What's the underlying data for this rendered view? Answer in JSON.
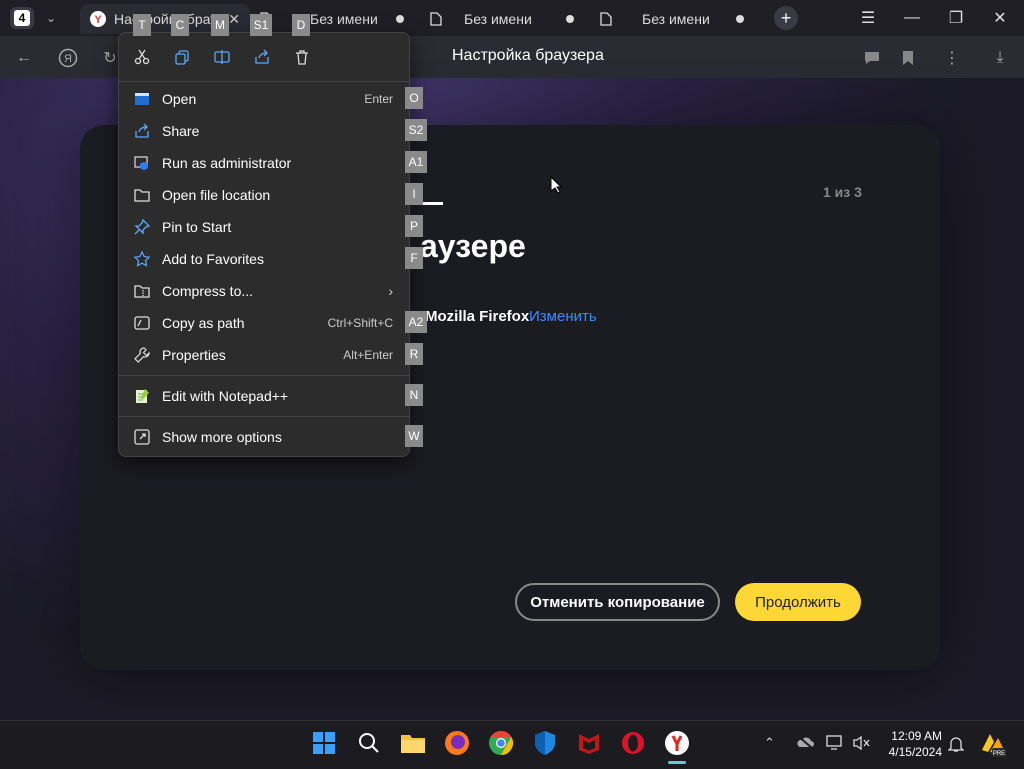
{
  "tabstrip": {
    "tab_count": "4",
    "tabs": [
      {
        "label": "Настройка брау"
      },
      {
        "label": "Без имени"
      },
      {
        "label": "Без имени"
      },
      {
        "label": "Без имени"
      }
    ],
    "new_tab": "+"
  },
  "toolbar": {
    "address_text": "Настройка браузера"
  },
  "page": {
    "step": "1 из 3",
    "heading_fragment": "аузере",
    "source_browser": "Mozilla Firefox",
    "change_link": "Изменить",
    "cancel_button": "Отменить копирование",
    "continue_button": "Продолжить"
  },
  "context_menu": {
    "top_actions": [
      {
        "icon": "cut-icon",
        "key": "T"
      },
      {
        "icon": "copy-icon",
        "key": "C"
      },
      {
        "icon": "rename-icon",
        "key": "M"
      },
      {
        "icon": "share-icon",
        "key": "S1"
      },
      {
        "icon": "delete-icon",
        "key": "D"
      }
    ],
    "items": [
      {
        "label": "Open",
        "shortcut": "Enter",
        "key": "O",
        "icon": "open-icon"
      },
      {
        "label": "Share",
        "shortcut": "",
        "key": "S2",
        "icon": "share-icon"
      },
      {
        "label": "Run as administrator",
        "shortcut": "",
        "key": "A1",
        "icon": "shield-icon"
      },
      {
        "label": "Open file location",
        "shortcut": "",
        "key": "I",
        "icon": "folder-icon"
      },
      {
        "label": "Pin to Start",
        "shortcut": "",
        "key": "P",
        "icon": "pin-icon"
      },
      {
        "label": "Add to Favorites",
        "shortcut": "",
        "key": "F",
        "icon": "star-icon"
      },
      {
        "label": "Compress to...",
        "shortcut": "",
        "key": "",
        "icon": "zip-icon",
        "submenu": true
      },
      {
        "label": "Copy as path",
        "shortcut": "Ctrl+Shift+C",
        "key": "A2",
        "icon": "path-icon"
      },
      {
        "label": "Properties",
        "shortcut": "Alt+Enter",
        "key": "R",
        "icon": "wrench-icon"
      },
      {
        "label": "Edit with Notepad++",
        "shortcut": "",
        "key": "N",
        "icon": "notepad-icon"
      },
      {
        "label": "Show more options",
        "shortcut": "",
        "key": "W",
        "icon": "more-options-icon"
      }
    ]
  },
  "taskbar": {
    "time": "12:09 AM",
    "date": "4/15/2024"
  },
  "colors": {
    "accent_yellow": "#fdd835",
    "link_blue": "#3d8bff",
    "menu_bg": "#2c2c2c"
  }
}
